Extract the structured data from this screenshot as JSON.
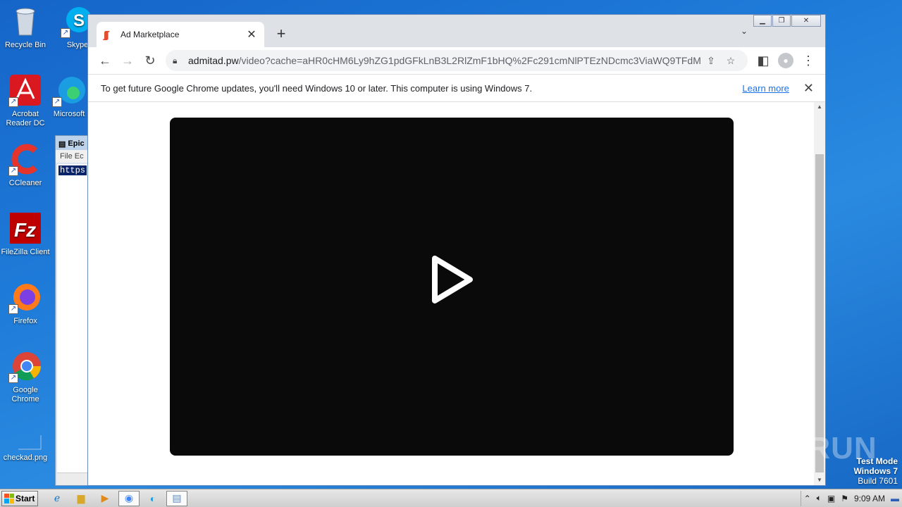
{
  "desktop": {
    "icons": [
      {
        "label": "Recycle Bin",
        "icon": "recycle-bin-icon"
      },
      {
        "label": "Skype",
        "icon": "skype-icon"
      },
      {
        "label": "Acrobat Reader DC",
        "icon": "acrobat-icon"
      },
      {
        "label": "Microsoft",
        "icon": "edge-icon"
      },
      {
        "label": "CCleaner",
        "icon": "ccleaner-icon"
      },
      {
        "label": "FileZilla Client",
        "icon": "filezilla-icon"
      },
      {
        "label": "Firefox",
        "icon": "firefox-icon"
      },
      {
        "label": "Google Chrome",
        "icon": "chrome-icon"
      },
      {
        "label": "checkad.png",
        "icon": "image-file-icon"
      }
    ],
    "watermark": "ANY RUN",
    "test_mode": {
      "line1": "Test Mode",
      "line2": "Windows 7",
      "line3": "Build 7601"
    }
  },
  "notepad": {
    "title": "Epic",
    "menu": "File  Ec",
    "selected_text": "https"
  },
  "browser": {
    "tab": {
      "title": "Ad Marketplace"
    },
    "url_host": "admitad.pw",
    "url_path": "/video?cache=aHR0cHM6Ly9hZG1pdGFkLnB3L2RlZmF1bHQ%2Fc291cmNlPTEzNDcmc3ViaWQ9TFdMU...",
    "infobar": {
      "message": "To get future Google Chrome updates, you'll need Windows 10 or later. This computer is using Windows 7.",
      "link": "Learn more"
    }
  },
  "taskbar": {
    "start_label": "Start",
    "clock": "9:09 AM"
  }
}
